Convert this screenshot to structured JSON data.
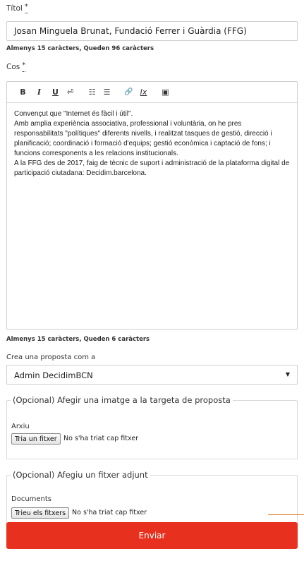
{
  "title_field": {
    "label": "Títol",
    "required_mark": "*",
    "value": "Josan Minguela Brunat, Fundació Ferrer i Guàrdia (FFG)",
    "hint": "Almenys 15 caràcters, Queden 96 caràcters"
  },
  "body_field": {
    "label": "Cos",
    "required_mark": "*",
    "toolbar": {
      "bold": "B",
      "italic": "I",
      "underline": "U",
      "video": "⏎",
      "ordered_list": "☷",
      "bullet_list": "☰",
      "link": "🔗",
      "clear_format": "Ix",
      "image": "▣"
    },
    "paragraphs": [
      "Convençut que \"Internet és fàcil i útil\".",
      "Amb amplia experiència associativa, professional i voluntària, on he pres responsabilitats \"polítiques\" diferents nivells, i realitzat tasques de gestió, direcció i planificació; coordinació i formació d'equips; gestió econòmica i captació de fons; i funcions corresponents a les relacions institucionals.",
      "A la FFG des de 2017, faig de tècnic de suport i administració de la plataforma digital de participació ciutadana: Decidim.barcelona."
    ],
    "hint": "Almenys 15 caràcters, Queden 6 caràcters"
  },
  "author_field": {
    "label": "Crea una proposta com a",
    "selected": "Admin DecidimBCN",
    "arrow": "▼"
  },
  "image_fieldset": {
    "legend": "(Opcional) Afegir una imatge a la targeta de proposta",
    "file_label": "Arxiu",
    "button": "Tria un fitxer",
    "status": "No s'ha triat cap fitxer"
  },
  "attachment_fieldset": {
    "legend": "(Opcional) Afegiu un fitxer adjunt",
    "file_label": "Documents",
    "button": "Trieu els fitxers",
    "status": "No s'ha triat cap fitxer"
  },
  "submit": {
    "label": "Enviar"
  },
  "colors": {
    "submit": "#e8301e",
    "border": "#cfcfcf",
    "accent_line": "#e07a2c"
  }
}
